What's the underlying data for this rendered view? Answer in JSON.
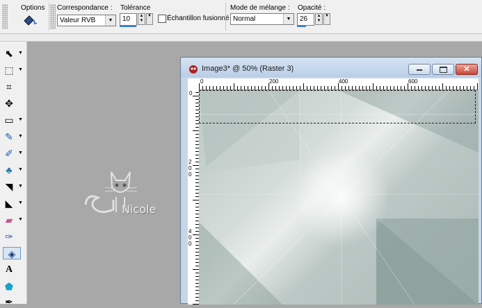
{
  "options": {
    "label": "Options",
    "match_mode_label": "Correspondance :",
    "match_mode_value": "Valeur RVB",
    "tolerance_label": "Tolérance",
    "tolerance_value": "10",
    "sample_merged_label": "Échantillon fusionné",
    "blend_mode_label": "Mode de mélange :",
    "blend_mode_value": "Normal",
    "opacity_label": "Opacité :",
    "opacity_value": "26"
  },
  "tools": [
    {
      "icon": "pointer-icon",
      "glyph": "⬉"
    },
    {
      "icon": "selection-icon",
      "glyph": "⬚"
    },
    {
      "icon": "crop-icon",
      "glyph": "⌗"
    },
    {
      "icon": "move-icon",
      "glyph": "✥"
    },
    {
      "icon": "freehand-selection-icon",
      "glyph": "▭"
    },
    {
      "icon": "dropper-icon",
      "glyph": "✎"
    },
    {
      "icon": "paint-brush-icon",
      "glyph": "✐"
    },
    {
      "icon": "clone-brush-icon",
      "glyph": "♣"
    },
    {
      "icon": "retouch-icon",
      "glyph": "◥"
    },
    {
      "icon": "dodge-icon",
      "glyph": "◣"
    },
    {
      "icon": "eraser-icon",
      "glyph": "▰"
    },
    {
      "icon": "picture-tube-icon",
      "glyph": "✑"
    },
    {
      "icon": "flood-fill-icon",
      "glyph": "◈"
    },
    {
      "icon": "text-icon",
      "glyph": "A"
    },
    {
      "icon": "shape-icon",
      "glyph": "⬟"
    },
    {
      "icon": "pen-icon",
      "glyph": "✒"
    }
  ],
  "watermark": {
    "text": "Nicole"
  },
  "window": {
    "title": "Image3* @  50% (Raster 3)",
    "ruler_top_labels": [
      "0",
      "200",
      "400",
      "600"
    ],
    "ruler_left_labels": [
      "0",
      "200",
      "400"
    ]
  }
}
